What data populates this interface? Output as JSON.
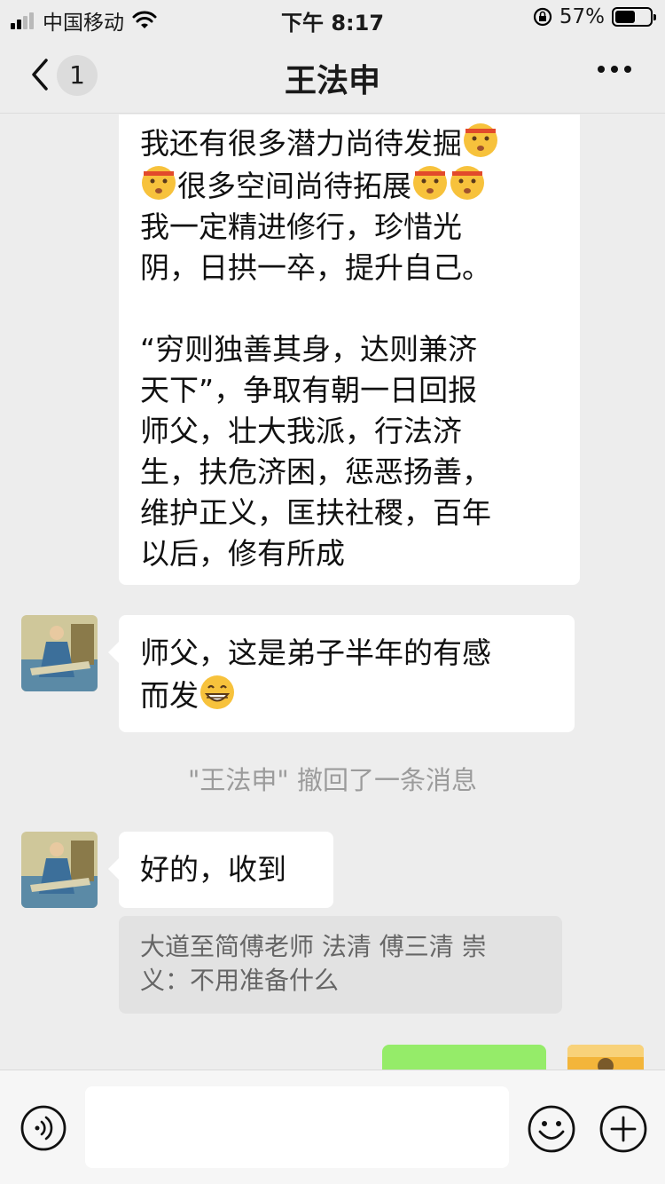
{
  "status_bar": {
    "carrier": "中国移动",
    "time": "下午 8:17",
    "battery_percent": "57%",
    "battery_level": 0.57
  },
  "nav": {
    "back_label": "‹",
    "unread_count": "1",
    "title": "王法申",
    "more_icon": "more-dots-icon"
  },
  "messages": {
    "long_lines_a": [
      "我还有很多潜力尚待发掘",
      "很多空间尚待拓展",
      "我一定精进修行，珍惜光",
      "阴，日拱一卒，提升自己。"
    ],
    "long_lines_b": [
      "“穷则独善其身，达则兼济",
      "天下”，争取有朝一日回报",
      "师父，壮大我派，行法济",
      "生，扶危济困，惩恶扬善，",
      "维护正义，匡扶社稷，百年",
      "以后，修有所成"
    ],
    "reply_lines": [
      "师父，这是弟子半年的有感",
      "而发"
    ],
    "recall_notice": "\"王法申\" 撤回了一条消息",
    "ack": "好的，收到",
    "quote_lines": [
      "大道至简傅老师 法清 傅三清 崇",
      "义：不用准备什么"
    ]
  },
  "input_bar": {
    "placeholder": ""
  },
  "colors": {
    "background": "#ededed",
    "bubble": "#ffffff",
    "my_bubble": "#95ec69",
    "quote_bg": "#e2e2e2"
  }
}
